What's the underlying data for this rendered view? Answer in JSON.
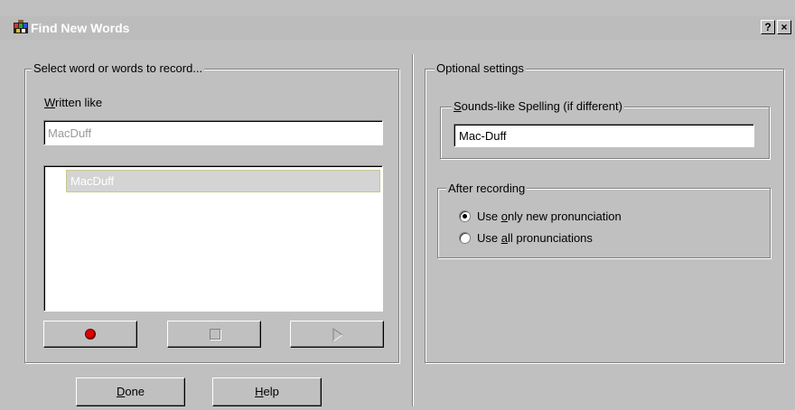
{
  "window": {
    "title": "Find New Words",
    "help_button": "?",
    "close_button": "×"
  },
  "left_group": {
    "legend": "Select word or words to record...",
    "written_like_label_u": "W",
    "written_like_label_rest": "ritten like",
    "input_value": "MacDuff",
    "list_items": [
      "MacDuff"
    ]
  },
  "controls": {
    "record_icon": "record-icon",
    "stop_icon": "stop-icon",
    "play_icon": "play-icon"
  },
  "buttons": {
    "done_u": "D",
    "done_rest": "one",
    "help_u": "H",
    "help_rest": "elp"
  },
  "optional": {
    "legend": "Optional settings",
    "sounds_like": {
      "legend_u": "S",
      "legend_rest": "ounds-like Spelling (if different)",
      "value": "Mac-Duff"
    },
    "after_recording": {
      "legend": "After recording",
      "options": [
        {
          "pre": "Use ",
          "u": "o",
          "post": "nly new pronunciation",
          "selected": true
        },
        {
          "pre": "Use ",
          "u": "a",
          "post": "ll pronunciations",
          "selected": false
        }
      ]
    }
  },
  "colors": {
    "title_bg": "#bcbcbc",
    "dialog_bg": "#c0c0c0",
    "record_red": "#e00000"
  }
}
